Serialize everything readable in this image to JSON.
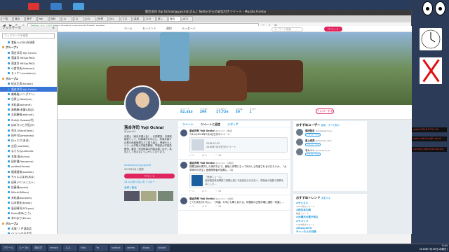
{
  "window_title": "落合洋司 Yoji Ochiai(@yjochi3)さん | Twitterからの返信付きツイート - Mozilla Firefox",
  "tabs": [
    "一覧",
    "落合",
    "昌子",
    "Yoji",
    "百科",
    "(1)",
    "(1)",
    "(4)",
    "世界",
    "(4)",
    "プロ",
    "高校",
    "(20)",
    "新し",
    "落合",
    "ACS"
  ],
  "url": "https://twitter.com/yjochi3/with_replies",
  "url_label": "Twitter, Inc. (US)",
  "bookmarks": [
    "百科",
    "一般",
    "ジャ",
    "(1)",
    "ニュ",
    "(1)",
    "世界",
    "(20)",
    "北海",
    "岩手",
    "Yaho",
    "Goo",
    "日本",
    "高校",
    "新",
    "落合"
  ],
  "sidebar": {
    "title": "ブックマーク",
    "search_placeholder": "ブックマークを検索",
    "items": [
      {
        "label": "看板へ(OSK)を検索",
        "folder": false
      },
      {
        "label": "グループ1",
        "folder": true
      },
      {
        "label": "落合洋司 Yoji Ochiai",
        "folder": false
      },
      {
        "label": "落渡洋 HEGo(PhD)",
        "folder": false
      },
      {
        "label": "落渡洋 HEGo(PhD)",
        "folder": false
      },
      {
        "label": "小倉秀夫(hiderosi)",
        "folder": false
      },
      {
        "label": "モトケン(motoken)",
        "folder": false
      },
      {
        "label": "グループ2",
        "folder": true
      },
      {
        "label": "紀本正男(hiroeki)",
        "folder": false
      },
      {
        "label": "落合洋司 Yoji Ochiai",
        "folder": false,
        "selected": true
      },
      {
        "label": "森嶋裕(ハングクン)",
        "folder": false
      },
      {
        "label": "谷原士(Yoshijun)",
        "folder": false
      },
      {
        "label": "末松誠(akirahit)",
        "folder": false
      },
      {
        "label": "高橋康(未議)(あほ)",
        "folder": false
      },
      {
        "label": "吉田康裕(akijunk)",
        "folder": false
      },
      {
        "label": "Shikiji Opawa(代)",
        "folder": false
      },
      {
        "label": "ほぼけいとが長(か)",
        "folder": false
      },
      {
        "label": "秀木 (MachiTami)",
        "folder": false
      },
      {
        "label": "田中 知(amoerao)",
        "folder": false
      },
      {
        "label": "ほっとけ(あほ)",
        "folder": false
      },
      {
        "label": "吉田 (oorikok)",
        "folder": false
      },
      {
        "label": "まえもんJunkunio",
        "folder": false
      },
      {
        "label": "本城 真(kuruo)",
        "folder": false
      },
      {
        "label": "田村健(Yamanon)",
        "folder": false
      },
      {
        "label": "yohko(Hirano)",
        "folder": false
      },
      {
        "label": "福浦昌裕(soulfoe)",
        "folder": false
      },
      {
        "label": "ちゃんぷまあ(あま)",
        "folder": false
      },
      {
        "label": "田草(ベリテニスト)",
        "folder": false
      },
      {
        "label": "佐藤靖(asahi)",
        "folder": false
      },
      {
        "label": "Mitchi(Mikes)",
        "folder": false
      },
      {
        "label": "末松誠(kurosen)",
        "folder": false
      },
      {
        "label": "山本勉夫(kyose)",
        "folder": false
      },
      {
        "label": "島田晴司(SOLyon)",
        "folder": false
      },
      {
        "label": "Duko末末(こう)",
        "folder": false
      },
      {
        "label": "本川まり(Kimo)",
        "folder": false
      },
      {
        "label": "グループ2",
        "folder": true
      },
      {
        "label": "本城 リ 戸部誌会",
        "folder": false
      },
      {
        "label": "O(1)(1)の日本語",
        "folder": false
      }
    ]
  },
  "twitter": {
    "nav": [
      "ホーム",
      "モーメント",
      "通知",
      "メッセージ"
    ],
    "search_placeholder": "キーワード検索",
    "tweet_button": "ツイート",
    "stats": [
      {
        "label": "ツイート",
        "value": "82,343"
      },
      {
        "label": "フォロー",
        "value": "299"
      },
      {
        "label": "フォロワー",
        "value": "17,726"
      },
      {
        "label": "いいね",
        "value": "30"
      },
      {
        "label": "リスト",
        "value": "1"
      }
    ],
    "follow_button": "フォローする",
    "profile": {
      "name": "落合洋司 Yoji Ochiai",
      "handle": "@yjochi3",
      "bio": "弁護士（東京弁護士会）。元検察官。法律実務家として、刑事事件を中心に、刑事弁護や企業の危機管理などに取り組む。情報セキュリティ大学院大学客員教授、早稲田大学客員教授。著書『熱血検事の刑事弁護』ほか。私見として気ままにつぶやいております。",
      "link": "d.hatena.ne.jp/yjochi3",
      "joined": "2009年4月に登録",
      "tweet_button": "ツイート",
      "followers_you_know": "24人の知り合いをフォロー",
      "media_label": "画像と動画"
    },
    "timeline_tabs": [
      "ツイート",
      "ツイートと返信",
      "メディア"
    ],
    "tweets": [
      {
        "name": "落合洋司 Yoji Ochiai",
        "handle": "@yjochi3 · 8時間",
        "text": "7/4(in)2018年7月4日日付のツイート",
        "card_title": "2018-07-03",
        "card_text": "2018年7月3日付のツイート"
      },
      {
        "name": "落合洋司 Yoji Ochiai",
        "handle": "@yjochi3 · 19時間",
        "text": "検察当局が関与した事件などで、最後に有罪になって何かしら改善されるのだろうか。「大学時代の先生」医療関係者が話題に、(2)",
        "card_title": "「医療ニュース」",
        "card_text": "官房機密費用問題で検察は遂に不起訴処分を決定へ、関係者が複数の疑問を口にした…"
      },
      {
        "name": "落合洋司 Yoji Ochiai",
        "handle": "@yjochi3 · 19時間",
        "text": "とても気を付けたい。「共謀」の中にも罪とあたる、特捜部の正規手順に通知「共謀」…",
        "card_title": "",
        "card_text": ""
      }
    ],
    "actions": [
      "1",
      "5",
      "16"
    ],
    "who_to_follow": {
      "title": "おすすめユーザー",
      "refresh": "更新 · すべて表示",
      "users": [
        {
          "name": "紫田智良",
          "handle": "@shibatatomoyo",
          "button": "フォローする"
        },
        {
          "name": "真上武美",
          "handle": "@hawaiian_taku",
          "button": "フォローする"
        },
        {
          "name": "モキトン",
          "handle": "@mokinton_sz",
          "button": "フォローする"
        }
      ]
    },
    "trends": {
      "title": "おすすめトレンド",
      "change": "変更する",
      "items": [
        {
          "tag": "#せいさい",
          "sub": "2,011件のツイート"
        },
        {
          "tag": "#西日本大雨",
          "sub": "関連ツイート"
        },
        {
          "tag": "#水曜日の夏が来る",
          "sub": ""
        },
        {
          "tag": "#チバソバ",
          "sub": "3,432件のツイート"
        },
        {
          "tag": "#MaxxieF5",
          "sub": ""
        },
        {
          "tag": "チャンネルの日様",
          "sub": ""
        }
      ]
    }
  },
  "desktop_terms": [
    "yokai-2018-0712-0k",
    "asahi-add-my@-uta-#",
    "commy-v@2018-2018-0"
  ],
  "taskbar": {
    "tasks": [
      "アクール",
      "ルー Do",
      "落合洋",
      "emacs",
      "ルス.",
      "hito",
      "Yo",
      "scdock",
      "oeyes",
      "xlogo",
      "xclock"
    ],
    "time": "5:44",
    "date": "2018年7月18日(水曜日)"
  }
}
